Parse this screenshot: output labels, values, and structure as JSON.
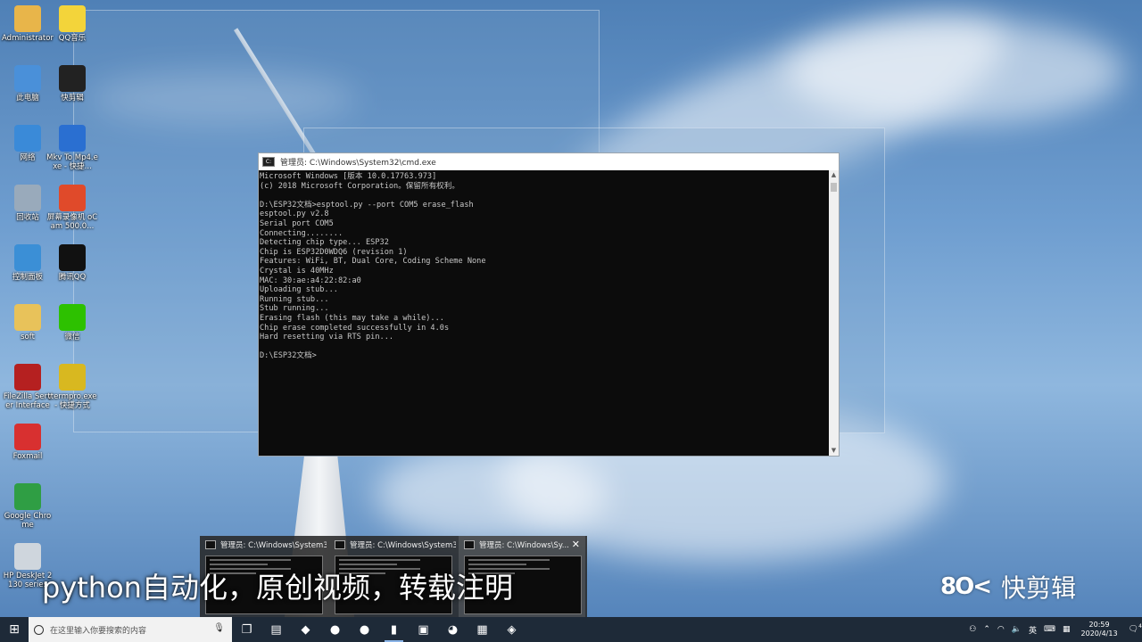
{
  "desktop_icons": [
    {
      "label": "Administrator",
      "icon": "user-folder-icon",
      "color": "#e8b54a"
    },
    {
      "label": "QQ音乐",
      "icon": "qq-music-icon",
      "color": "#f3d43a"
    },
    {
      "label": "此电脑",
      "icon": "computer-icon",
      "color": "#4a90d9"
    },
    {
      "label": "快剪辑",
      "icon": "kuaijianji-icon",
      "color": "#222222"
    },
    {
      "label": "网络",
      "icon": "network-icon",
      "color": "#3a8ad8"
    },
    {
      "label": "Mkv To Mp4.exe - 快捷...",
      "icon": "video-converter-icon",
      "color": "#2a6fd1"
    },
    {
      "label": "回收站",
      "icon": "recycle-bin-icon",
      "color": "#9ab"
    },
    {
      "label": "屏幕录像机 oCam 500.0...",
      "icon": "ocam-icon",
      "color": "#e04a2a"
    },
    {
      "label": "控制面板",
      "icon": "control-panel-icon",
      "color": "#3b8fd6"
    },
    {
      "label": "腾讯QQ",
      "icon": "qq-icon",
      "color": "#111111"
    },
    {
      "label": "soft",
      "icon": "folder-icon",
      "color": "#e8c25a"
    },
    {
      "label": "微信",
      "icon": "wechat-icon",
      "color": "#2dc100"
    },
    {
      "label": "FileZilla Server Interface",
      "icon": "filezilla-icon",
      "color": "#b52020"
    },
    {
      "label": "ttermpro.exe - 快捷方式",
      "icon": "teraterm-icon",
      "color": "#d8b820"
    },
    {
      "label": "Foxmail",
      "icon": "foxmail-icon",
      "color": "#d83030"
    },
    {
      "label": "Google Chrome",
      "icon": "chrome-icon",
      "color": "#2f9e44"
    },
    {
      "label": "HP DeskJet 2130 series",
      "icon": "printer-icon",
      "color": "#cfd6dd"
    }
  ],
  "cmd": {
    "title": "管理员: C:\\Windows\\System32\\cmd.exe",
    "lines": [
      "Microsoft Windows [版本 10.0.17763.973]",
      "(c) 2018 Microsoft Corporation。保留所有权利。",
      "",
      "D:\\ESP32文档>esptool.py --port COM5 erase_flash",
      "esptool.py v2.8",
      "Serial port COM5",
      "Connecting........",
      "Detecting chip type... ESP32",
      "Chip is ESP32D0WDQ6 (revision 1)",
      "Features: WiFi, BT, Dual Core, Coding Scheme None",
      "Crystal is 40MHz",
      "MAC: 30:ae:a4:22:82:a0",
      "Uploading stub...",
      "Running stub...",
      "Stub running...",
      "Erasing flash (this may take a while)...",
      "Chip erase completed successfully in 4.0s",
      "Hard resetting via RTS pin...",
      "",
      "D:\\ESP32文档>"
    ]
  },
  "previews": [
    {
      "title": "管理员: C:\\Windows\\System3..."
    },
    {
      "title": "管理员: C:\\Windows\\System3..."
    },
    {
      "title": "管理员: C:\\Windows\\Sy..."
    }
  ],
  "preview_close": "✕",
  "subtitle": "python自动化，原创视频，转载注明",
  "watermark": {
    "logo": "8O<",
    "text": "快剪辑"
  },
  "taskbar": {
    "search_placeholder": "在这里输入你要搜索的内容",
    "apps": [
      {
        "icon": "task-view-icon",
        "glyph": "❐"
      },
      {
        "icon": "file-explorer-icon",
        "glyph": "▤"
      },
      {
        "icon": "app-blue-icon",
        "glyph": "◆"
      },
      {
        "icon": "chrome-icon",
        "glyph": "●"
      },
      {
        "icon": "green-app-icon",
        "glyph": "●"
      },
      {
        "icon": "cmd-icon",
        "glyph": "▮",
        "open": true
      },
      {
        "icon": "app-window-icon",
        "glyph": "▣"
      },
      {
        "icon": "wechat-icon",
        "glyph": "◕"
      },
      {
        "icon": "red-app-icon",
        "glyph": "▦"
      },
      {
        "icon": "network-app-icon",
        "glyph": "◈"
      }
    ],
    "tray": {
      "lang": "英",
      "time": "20:59",
      "date": "2020/4/13",
      "notify_count": "4"
    }
  }
}
